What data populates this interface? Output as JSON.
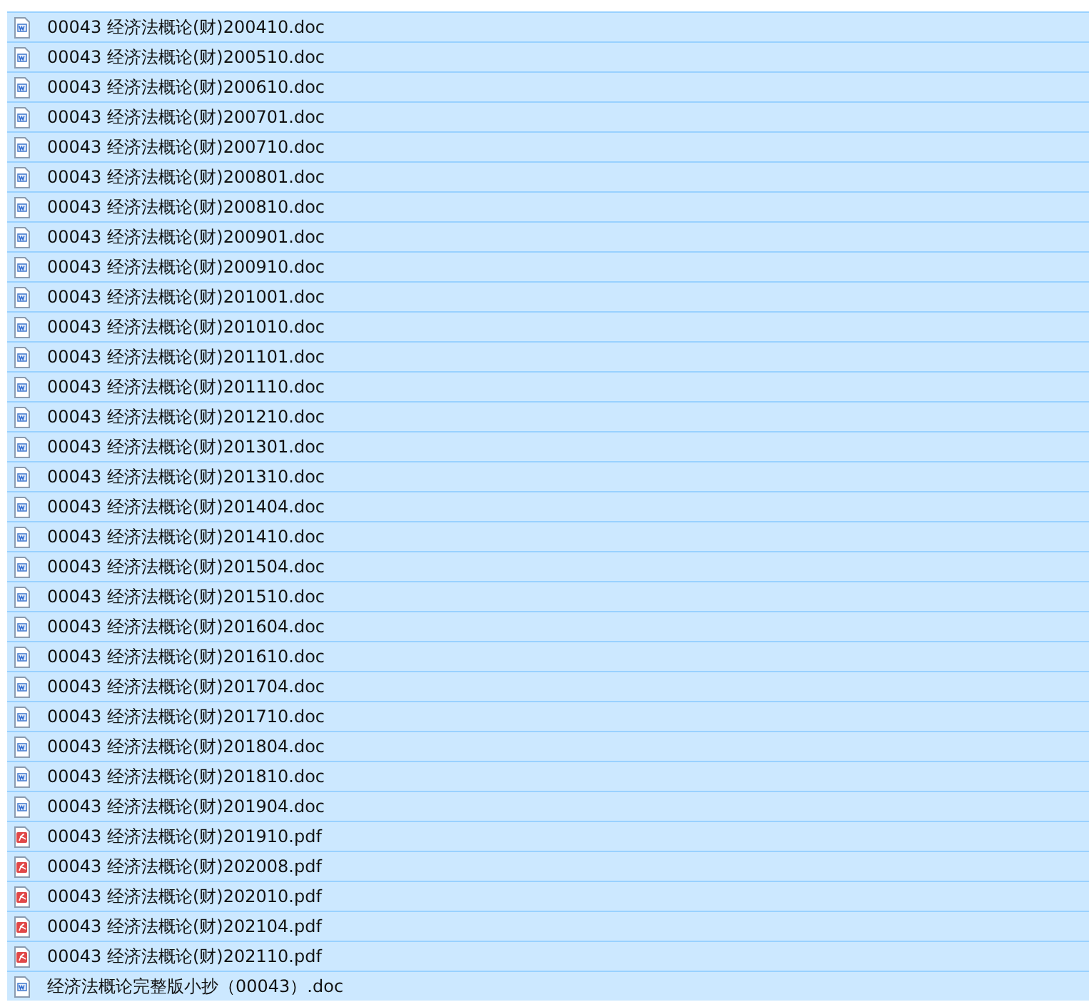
{
  "files": [
    {
      "name": "00043 经济法概论(财)200410.doc",
      "kind": "doc",
      "selected": true
    },
    {
      "name": "00043 经济法概论(财)200510.doc",
      "kind": "doc",
      "selected": true
    },
    {
      "name": "00043 经济法概论(财)200610.doc",
      "kind": "doc",
      "selected": true
    },
    {
      "name": "00043 经济法概论(财)200701.doc",
      "kind": "doc",
      "selected": true
    },
    {
      "name": "00043 经济法概论(财)200710.doc",
      "kind": "doc",
      "selected": true
    },
    {
      "name": "00043 经济法概论(财)200801.doc",
      "kind": "doc",
      "selected": true
    },
    {
      "name": "00043 经济法概论(财)200810.doc",
      "kind": "doc",
      "selected": true
    },
    {
      "name": "00043 经济法概论(财)200901.doc",
      "kind": "doc",
      "selected": true
    },
    {
      "name": "00043 经济法概论(财)200910.doc",
      "kind": "doc",
      "selected": true
    },
    {
      "name": "00043 经济法概论(财)201001.doc",
      "kind": "doc",
      "selected": true
    },
    {
      "name": "00043 经济法概论(财)201010.doc",
      "kind": "doc",
      "selected": true
    },
    {
      "name": "00043 经济法概论(财)201101.doc",
      "kind": "doc",
      "selected": true
    },
    {
      "name": "00043 经济法概论(财)201110.doc",
      "kind": "doc",
      "selected": true
    },
    {
      "name": "00043 经济法概论(财)201210.doc",
      "kind": "doc",
      "selected": true
    },
    {
      "name": "00043 经济法概论(财)201301.doc",
      "kind": "doc",
      "selected": true
    },
    {
      "name": "00043 经济法概论(财)201310.doc",
      "kind": "doc",
      "selected": true
    },
    {
      "name": "00043 经济法概论(财)201404.doc",
      "kind": "doc",
      "selected": true
    },
    {
      "name": "00043 经济法概论(财)201410.doc",
      "kind": "doc",
      "selected": true
    },
    {
      "name": "00043 经济法概论(财)201504.doc",
      "kind": "doc",
      "selected": true
    },
    {
      "name": "00043 经济法概论(财)201510.doc",
      "kind": "doc",
      "selected": true
    },
    {
      "name": "00043 经济法概论(财)201604.doc",
      "kind": "doc",
      "selected": true
    },
    {
      "name": "00043 经济法概论(财)201610.doc",
      "kind": "doc",
      "selected": true
    },
    {
      "name": "00043 经济法概论(财)201704.doc",
      "kind": "doc",
      "selected": true
    },
    {
      "name": "00043 经济法概论(财)201710.doc",
      "kind": "doc",
      "selected": true
    },
    {
      "name": "00043 经济法概论(财)201804.doc",
      "kind": "doc",
      "selected": true
    },
    {
      "name": "00043 经济法概论(财)201810.doc",
      "kind": "doc",
      "selected": true
    },
    {
      "name": "00043 经济法概论(财)201904.doc",
      "kind": "doc",
      "selected": true
    },
    {
      "name": "00043 经济法概论(财)201910.pdf",
      "kind": "pdf",
      "selected": true
    },
    {
      "name": "00043 经济法概论(财)202008.pdf",
      "kind": "pdf",
      "selected": true
    },
    {
      "name": "00043 经济法概论(财)202010.pdf",
      "kind": "pdf",
      "selected": true
    },
    {
      "name": "00043 经济法概论(财)202104.pdf",
      "kind": "pdf",
      "selected": true
    },
    {
      "name": "00043 经济法概论(财)202110.pdf",
      "kind": "pdf",
      "selected": true
    },
    {
      "name": "经济法概论完整版小抄（00043）.doc",
      "kind": "doc",
      "selected": true
    }
  ]
}
